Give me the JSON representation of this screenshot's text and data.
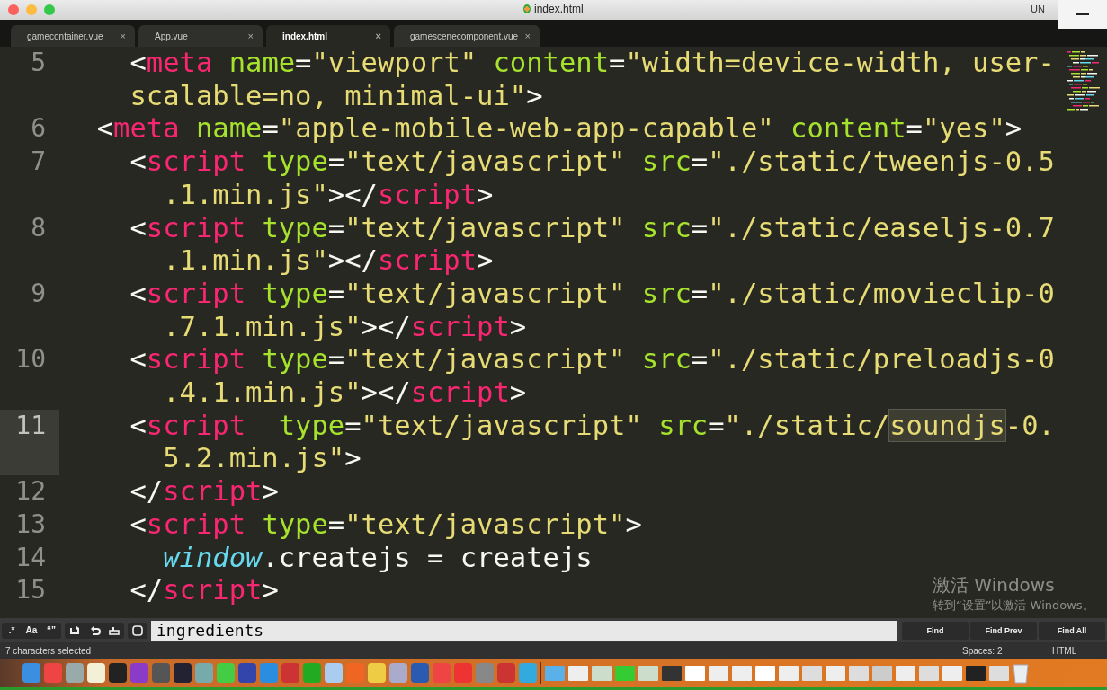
{
  "window": {
    "title": "index.html",
    "title_right": "UN"
  },
  "tabs": [
    {
      "label": "gamecontainer.vue",
      "close": "×",
      "selected": false
    },
    {
      "label": "App.vue",
      "close": "×",
      "selected": false
    },
    {
      "label": "index.html",
      "close": "×",
      "selected": true
    },
    {
      "label": "gamescenecomponent.vue",
      "close": "×",
      "selected": false
    }
  ],
  "editor": {
    "lines": [
      {
        "num": "5",
        "current": false,
        "rows": [
          "    <meta name=\"viewport\" content=\"width=device-width, user-",
          "    scalable=no, minimal-ui\">"
        ]
      },
      {
        "num": "6",
        "current": false,
        "rows": [
          "  <meta name=\"apple-mobile-web-app-capable\" content=\"yes\">"
        ]
      },
      {
        "num": "7",
        "current": false,
        "rows": [
          "    <script type=\"text/javascript\" src=\"./static/tweenjs-0.5",
          "      .1.min.js\"></script>"
        ]
      },
      {
        "num": "8",
        "current": false,
        "rows": [
          "    <script type=\"text/javascript\" src=\"./static/easeljs-0.7",
          "      .1.min.js\"></script>"
        ]
      },
      {
        "num": "9",
        "current": false,
        "rows": [
          "    <script type=\"text/javascript\" src=\"./static/movieclip-0",
          "      .7.1.min.js\"></script>"
        ]
      },
      {
        "num": "10",
        "current": false,
        "rows": [
          "    <script type=\"text/javascript\" src=\"./static/preloadjs-0",
          "      .4.1.min.js\"></script>"
        ]
      },
      {
        "num": "11",
        "current": true,
        "rows": [
          {
            "before": "    <script  type=\"text/javascript\" src=\"./static/",
            "match": "soundjs",
            "after": "-0."
          },
          "      5.2.min.js\">"
        ]
      },
      {
        "num": "12",
        "current": false,
        "rows": [
          "    </script>"
        ]
      },
      {
        "num": "13",
        "current": false,
        "rows": [
          "    <script type=\"text/javascript\">"
        ]
      },
      {
        "num": "14",
        "current": false,
        "rows": [
          "      window.createjs = createjs"
        ]
      },
      {
        "num": "15",
        "current": false,
        "rows": [
          "    </script>"
        ]
      }
    ]
  },
  "os_notice": {
    "title": "激活 Windows",
    "subtitle": "转到“设置”以激活 Windows。"
  },
  "find_panel": {
    "options": [
      {
        "label": ".*"
      },
      {
        "label": "Aa"
      },
      {
        "label": "“”"
      }
    ],
    "query": "ingredients",
    "buttons": [
      "Find",
      "Find Prev",
      "Find All"
    ]
  },
  "status_bar": {
    "message": "7 characters selected",
    "indent": "Spaces: 2",
    "syntax": "HTML"
  }
}
